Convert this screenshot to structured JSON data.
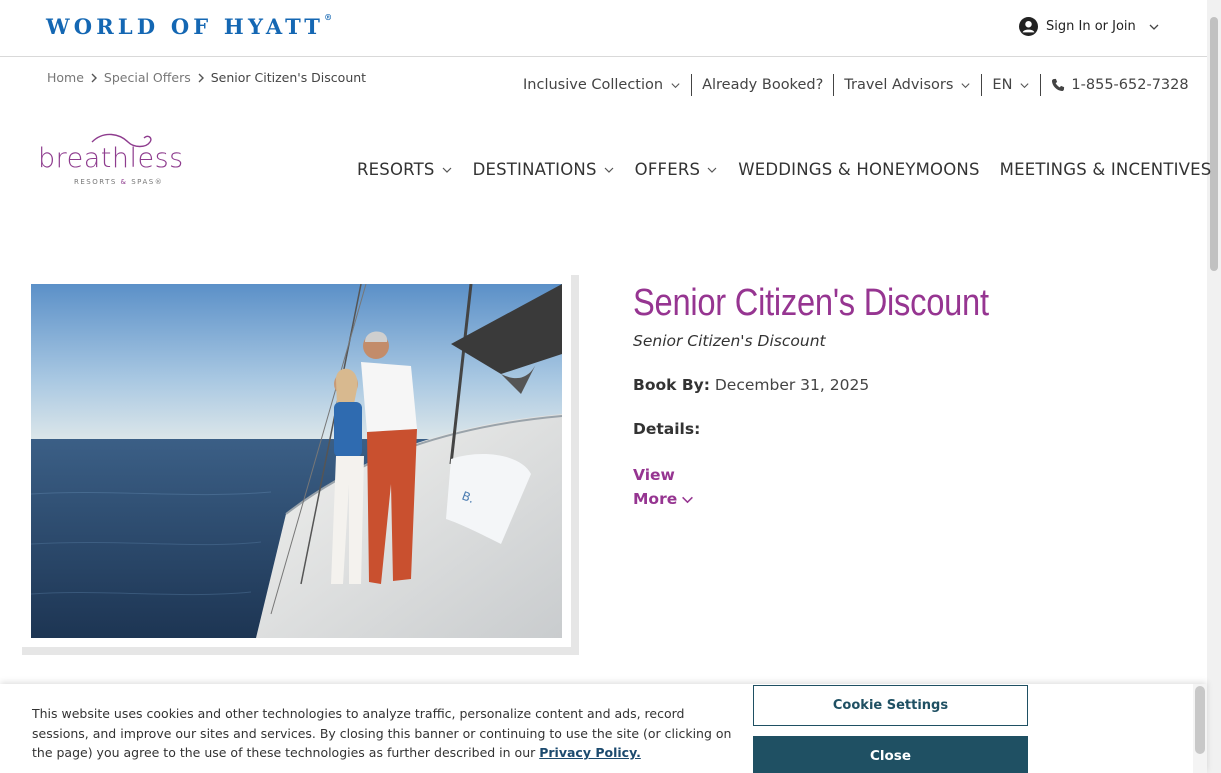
{
  "hyatt": {
    "logo": "WORLD OF HYATT",
    "logo_mark": "®",
    "signin_label": "Sign In or Join"
  },
  "breadcrumb": {
    "items": [
      "Home",
      "Special Offers",
      "Senior Citizen's Discount"
    ]
  },
  "utility_nav": {
    "inclusive": "Inclusive Collection",
    "booked": "Already Booked?",
    "advisors": "Travel Advisors",
    "language": "EN",
    "phone": "1-855-652-7328"
  },
  "brand": {
    "name": "breathless",
    "tagline_left": "RESORTS ",
    "tagline_amp": "&",
    "tagline_right": " SPAS",
    "tagline_mark": "®"
  },
  "main_nav": {
    "resorts": "RESORTS",
    "destinations": "DESTINATIONS",
    "offers": "OFFERS",
    "weddings": "WEDDINGS & HONEYMOONS",
    "meetings": "MEETINGS & INCENTIVES"
  },
  "offer": {
    "title": "Senior Citizen's Discount",
    "subtitle": "Senior Citizen's Discount",
    "book_by_label": "Book By:",
    "book_by_value": "December 31, 2025",
    "details_label": "Details:",
    "view_more_1": "View",
    "view_more_2": "More"
  },
  "cookie": {
    "text": "This website uses cookies and other technologies to analyze traffic, personalize content and ads, record sessions, and improve our sites and services. By closing this banner or continuing to use the site (or clicking on the page) you agree to the use of these technologies as further described in our ",
    "link": "Privacy Policy.",
    "settings_button": "Cookie Settings",
    "close_button": "Close"
  },
  "colors": {
    "hyatt_blue": "#1467b3",
    "brand_purple": "#963591",
    "cookie_teal": "#1f5063"
  },
  "icons": {
    "user": "user-circle-icon",
    "chevron": "chevron-down-icon",
    "breadcrumb_sep": "chevron-right-icon",
    "phone": "phone-icon"
  }
}
